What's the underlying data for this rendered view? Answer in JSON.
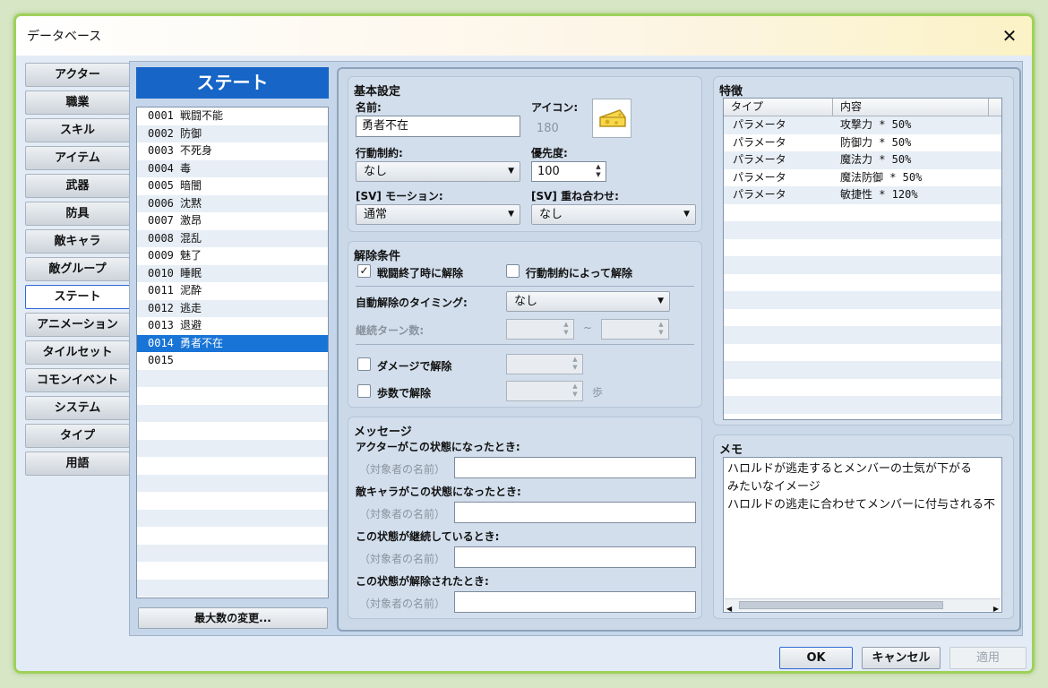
{
  "window": {
    "title": "データベース"
  },
  "tabs": [
    "アクター",
    "職業",
    "スキル",
    "アイテム",
    "武器",
    "防具",
    "敵キャラ",
    "敵グループ",
    "ステート",
    "アニメーション",
    "タイルセット",
    "コモンイベント",
    "システム",
    "タイプ",
    "用語"
  ],
  "active_tab": "ステート",
  "list": {
    "header": "ステート",
    "items": [
      {
        "id": "0001",
        "name": "戦闘不能"
      },
      {
        "id": "0002",
        "name": "防御"
      },
      {
        "id": "0003",
        "name": "不死身"
      },
      {
        "id": "0004",
        "name": "毒"
      },
      {
        "id": "0005",
        "name": "暗闇"
      },
      {
        "id": "0006",
        "name": "沈黙"
      },
      {
        "id": "0007",
        "name": "激昂"
      },
      {
        "id": "0008",
        "name": "混乱"
      },
      {
        "id": "0009",
        "name": "魅了"
      },
      {
        "id": "0010",
        "name": "睡眠"
      },
      {
        "id": "0011",
        "name": "泥酔"
      },
      {
        "id": "0012",
        "name": "逃走"
      },
      {
        "id": "0013",
        "name": "退避"
      },
      {
        "id": "0014",
        "name": "勇者不在"
      },
      {
        "id": "0015",
        "name": ""
      }
    ],
    "selected_index": 13,
    "max_button": "最大数の変更..."
  },
  "basic": {
    "title": "基本設定",
    "name_label": "名前:",
    "name_value": "勇者不在",
    "icon_label": "アイコン:",
    "icon_index": "180",
    "restriction_label": "行動制約:",
    "restriction_value": "なし",
    "priority_label": "優先度:",
    "priority_value": "100",
    "motion_label": "[SV] モーション:",
    "motion_value": "通常",
    "overlay_label": "[SV] 重ね合わせ:",
    "overlay_value": "なし"
  },
  "removal": {
    "title": "解除条件",
    "battle_end_label": "戦闘終了時に解除",
    "battle_end_checked": true,
    "restriction_label": "行動制約によって解除",
    "restriction_checked": false,
    "auto_timing_label": "自動解除のタイミング:",
    "auto_timing_value": "なし",
    "turns_label": "継続ターン数:",
    "turns_sep": "~",
    "damage_label": "ダメージで解除",
    "damage_checked": false,
    "steps_label": "歩数で解除",
    "steps_checked": false,
    "steps_unit": "歩"
  },
  "messages": {
    "title": "メッセージ",
    "placeholder": "（対象者の名前）",
    "items": [
      {
        "label": "アクターがこの状態になったとき:",
        "value": ""
      },
      {
        "label": "敵キャラがこの状態になったとき:",
        "value": ""
      },
      {
        "label": "この状態が継続しているとき:",
        "value": ""
      },
      {
        "label": "この状態が解除されたとき:",
        "value": ""
      }
    ]
  },
  "traits": {
    "title": "特徴",
    "columns": [
      "タイプ",
      "内容"
    ],
    "rows": [
      {
        "type": "パラメータ",
        "content": "攻撃力 * 50%"
      },
      {
        "type": "パラメータ",
        "content": "防御力 * 50%"
      },
      {
        "type": "パラメータ",
        "content": "魔法力 * 50%"
      },
      {
        "type": "パラメータ",
        "content": "魔法防御 * 50%"
      },
      {
        "type": "パラメータ",
        "content": "敏捷性 * 120%"
      }
    ]
  },
  "memo": {
    "title": "メモ",
    "lines": [
      "ハロルドが逃走するとメンバーの士気が下がる",
      "みたいなイメージ",
      "ハロルドの逃走に合わせてメンバーに付与される不"
    ]
  },
  "buttons": {
    "ok": "OK",
    "cancel": "キャンセル",
    "apply": "適用"
  },
  "colors": {
    "accent": "#1665c7",
    "selected_row": "#1874d6",
    "window_border": "#9fd15a"
  },
  "icons": {
    "close": "close-icon",
    "state_icon": "cheese-icon"
  }
}
